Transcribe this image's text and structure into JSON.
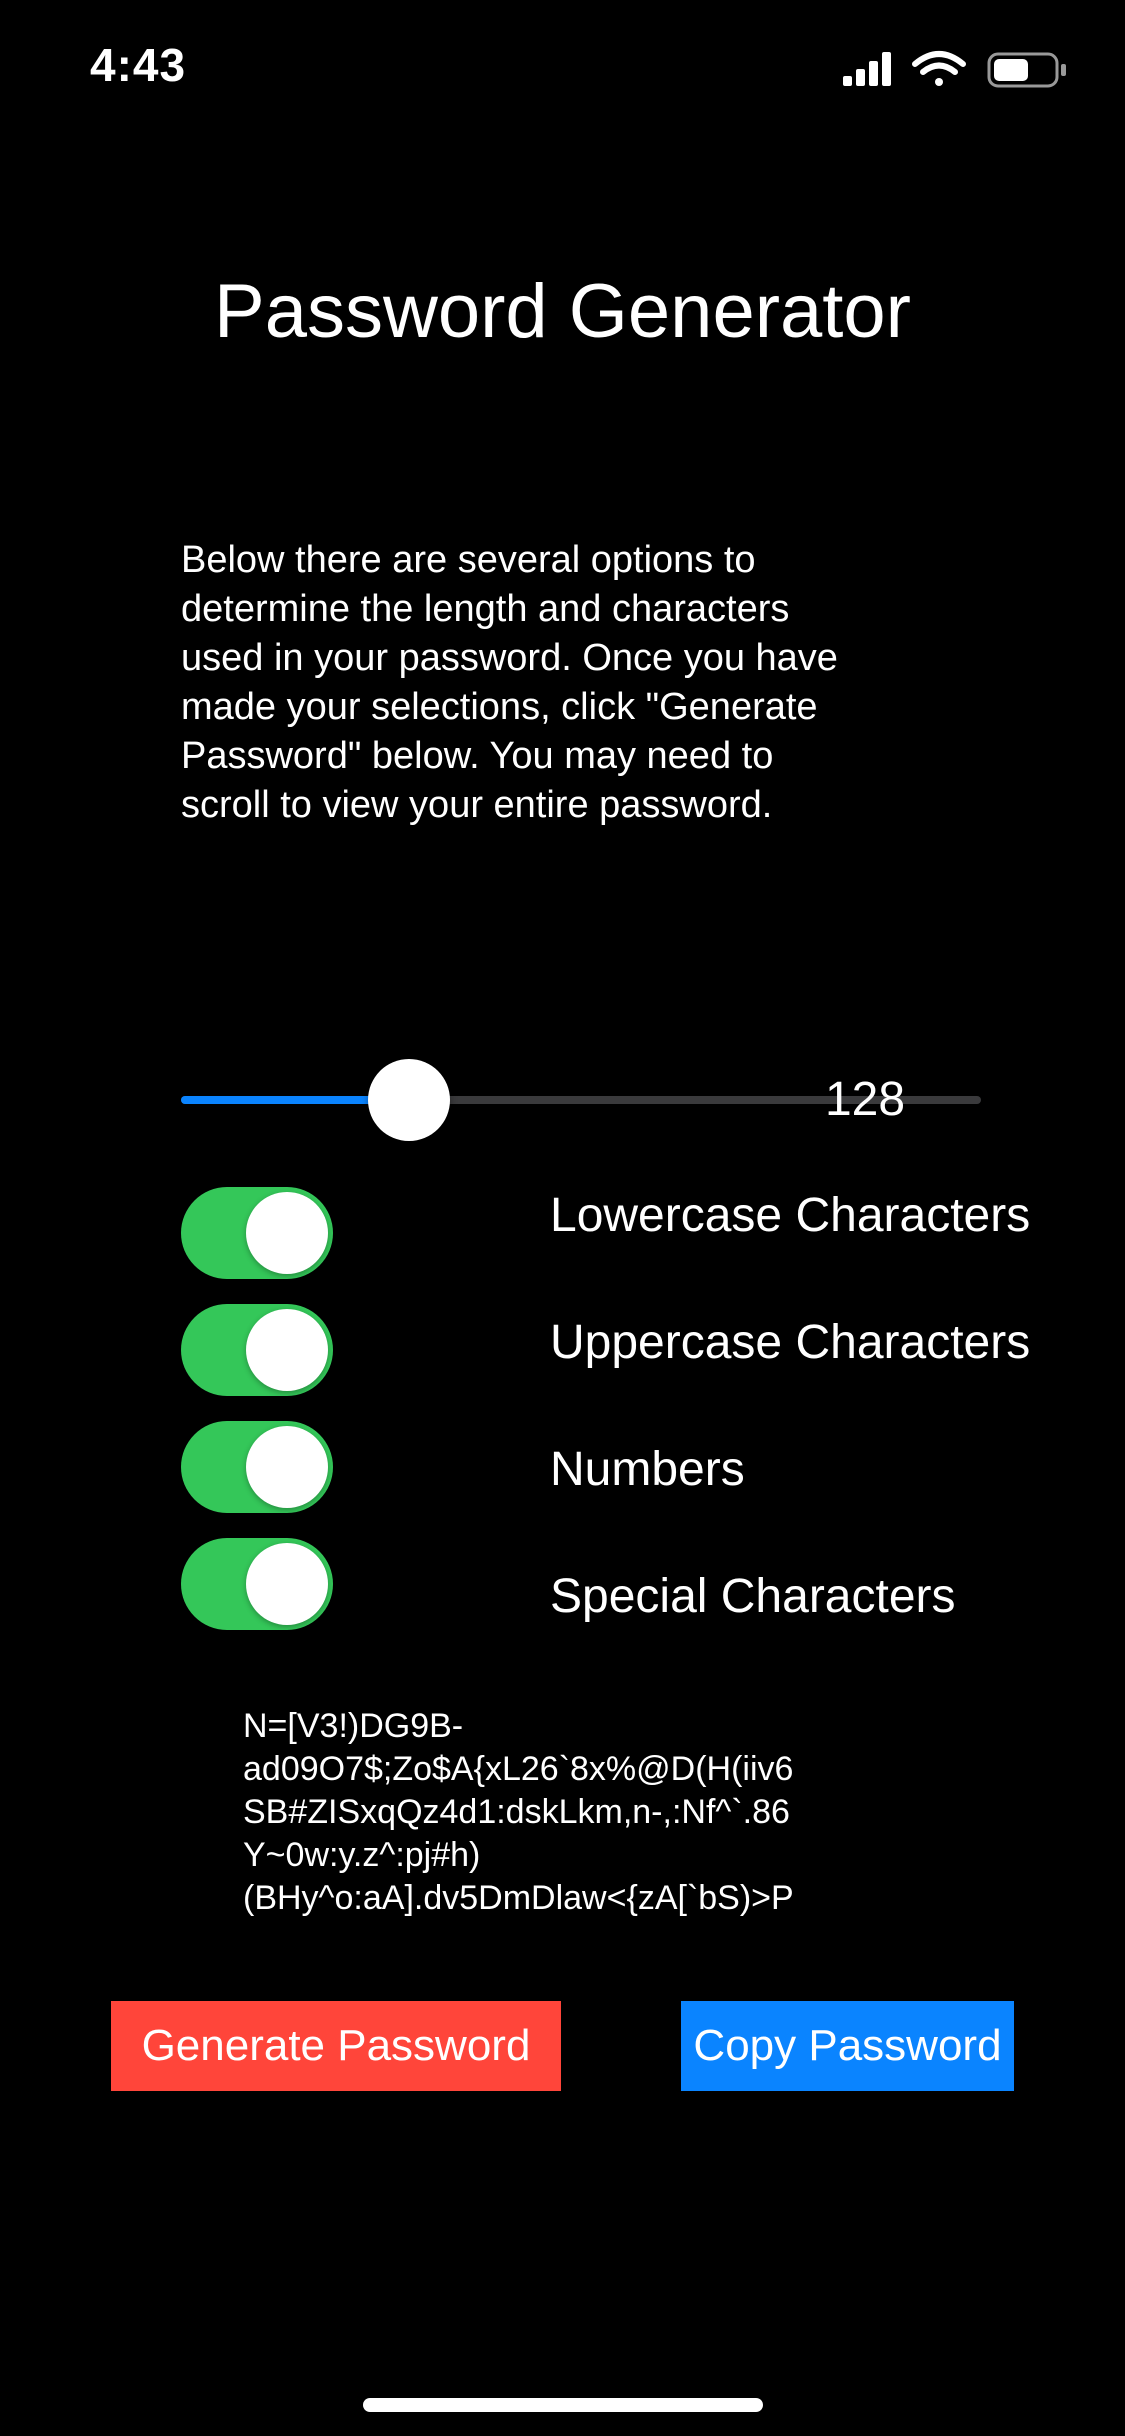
{
  "status_bar": {
    "time": "4:43",
    "icons": [
      "cellular-signal-icon",
      "wifi-icon",
      "battery-icon"
    ]
  },
  "title": "Password Generator",
  "description": "Below there are several options to\ndetermine the length and characters\nused in your password. Once you have\nmade your selections, click \"Generate\nPassword\" below. You may need to\nscroll to view your entire password.",
  "length_slider": {
    "value": 128,
    "value_label": "128",
    "fill_fraction": 0.285
  },
  "options": [
    {
      "label": "Lowercase Characters",
      "on": true
    },
    {
      "label": "Uppercase Characters",
      "on": true
    },
    {
      "label": "Numbers",
      "on": true
    },
    {
      "label": "Special Characters",
      "on": true
    }
  ],
  "password_text": "N=[V3!)DG9B-\nad09O7$;Zo$A{xL26`8x%@D(H(iiv6\nSB#ZISxqQz4d1:dskLkm,n-,:Nf^`.86\nY~0w:y.z^:pj#h)\n(BHy^o:aA].dv5DmDlaw<{zA[`bS)>P",
  "buttons": {
    "generate_label": "Generate Password",
    "copy_label": "Copy Password"
  },
  "colors": {
    "background": "#000000",
    "accent_blue": "#0a84ff",
    "toggle_green": "#34c759",
    "generate_red": "#ff453a"
  }
}
